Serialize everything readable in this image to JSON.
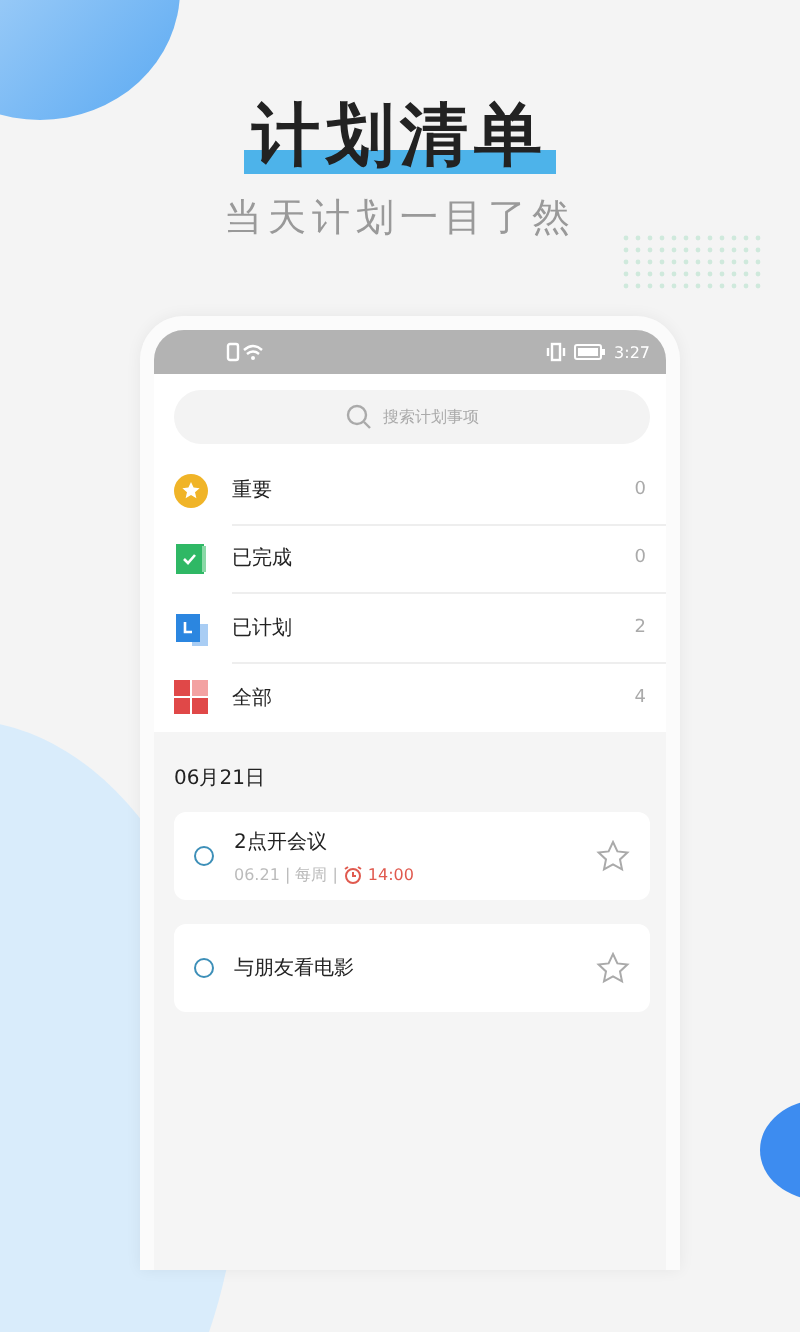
{
  "headline": "计划清单",
  "subtitle": "当天计划一目了然",
  "status_bar": {
    "time": "3:27"
  },
  "search": {
    "placeholder": "搜索计划事项"
  },
  "categories": [
    {
      "kind": "important",
      "label": "重要",
      "count": "0"
    },
    {
      "kind": "completed",
      "label": "已完成",
      "count": "0"
    },
    {
      "kind": "planned",
      "label": "已计划",
      "count": "2"
    },
    {
      "kind": "all",
      "label": "全部",
      "count": "4"
    }
  ],
  "date_header": "06月21日",
  "tasks": [
    {
      "title": "2点开会议",
      "done": false,
      "starred": false,
      "meta": "06.21 | 每周 |",
      "reminder": "14:00"
    },
    {
      "title": "与朋友看电影",
      "done": false,
      "starred": false
    }
  ]
}
